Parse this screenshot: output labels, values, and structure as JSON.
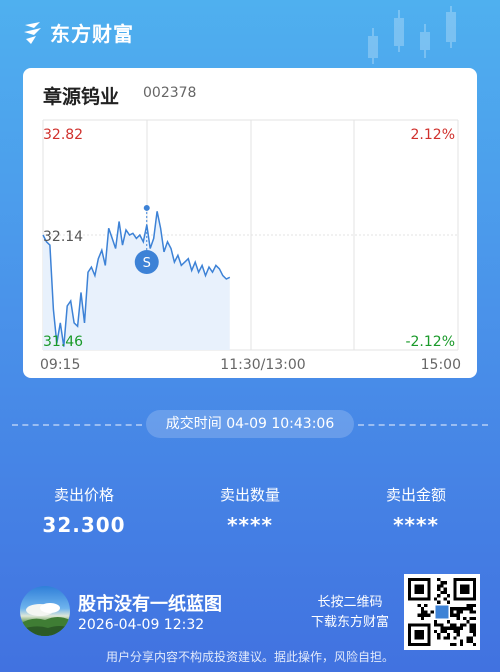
{
  "brand": {
    "name": "东方财富",
    "logo_icon": "eastmoney-logo-icon"
  },
  "stock": {
    "name": "章源钨业",
    "code": "002378"
  },
  "chart_data": {
    "type": "line",
    "title": "",
    "y_ticks_left": [
      "32.82",
      "32.14",
      "31.46"
    ],
    "y_ticks_right": [
      "2.12%",
      "",
      "-2.12%"
    ],
    "x_ticks": [
      "09:15",
      "11:30/13:00",
      "15:00"
    ],
    "ylim": [
      31.46,
      32.82
    ],
    "reference_price": 32.14,
    "colors": {
      "up": "#d0312d",
      "down": "#1a9a2a",
      "line": "#3d82d6",
      "fill": "#e8f1fc"
    },
    "x": [
      0,
      2,
      4,
      6,
      8,
      10,
      12,
      14,
      16,
      18,
      20,
      22,
      24,
      26,
      28,
      30,
      32,
      34,
      36,
      38,
      40,
      42,
      44,
      46,
      48,
      50,
      52,
      54,
      56,
      58,
      60,
      62,
      64,
      66,
      68,
      70,
      72,
      74,
      76,
      78,
      80,
      82,
      84,
      86,
      88,
      90,
      92,
      94,
      96,
      98,
      100,
      102,
      104,
      106,
      108
    ],
    "y": [
      32.14,
      32.1,
      32.08,
      31.7,
      31.5,
      31.62,
      31.48,
      31.72,
      31.75,
      31.62,
      31.6,
      31.8,
      31.62,
      31.92,
      31.95,
      31.9,
      32.0,
      32.05,
      31.96,
      32.18,
      32.12,
      32.06,
      32.22,
      32.08,
      32.17,
      32.14,
      32.15,
      32.12,
      32.14,
      32.1,
      32.2,
      32.06,
      32.12,
      32.28,
      32.18,
      32.04,
      32.1,
      32.06,
      31.98,
      32.02,
      31.96,
      31.98,
      32.0,
      31.93,
      31.98,
      31.92,
      31.96,
      31.9,
      31.95,
      31.92,
      31.96,
      31.94,
      31.9,
      31.88,
      31.89
    ],
    "x_total": 240,
    "sell_marker": {
      "label": "S",
      "x": 60,
      "y": 31.98
    }
  },
  "trade_time": "成交时间 04-09 10:43:06",
  "stats": [
    {
      "label": "卖出价格",
      "value": "32.300"
    },
    {
      "label": "卖出数量",
      "value": "****"
    },
    {
      "label": "卖出金额",
      "value": "****"
    }
  ],
  "footer": {
    "username": "股市没有一纸蓝图",
    "datetime": "2026-04-09 12:32",
    "scan_tip_1": "长按二维码",
    "scan_tip_2": "下载东方财富",
    "disclaimer": "用户分享内容不构成投资建议。据此操作，风险自担。"
  }
}
